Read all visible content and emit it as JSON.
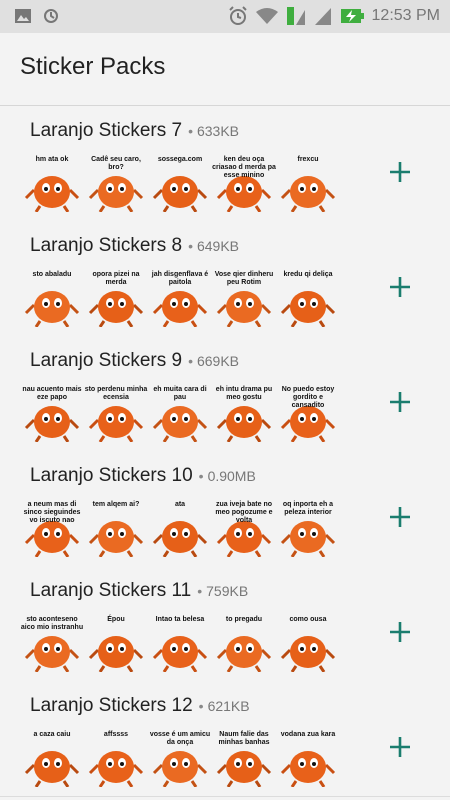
{
  "status_bar": {
    "time": "12:53 PM"
  },
  "app_bar": {
    "title": "Sticker Packs"
  },
  "colors": {
    "accent": "#1a7d6e",
    "orange": "#e8611a",
    "background": "#f3f3f3"
  },
  "packs": [
    {
      "name": "Laranjo Stickers 7",
      "size": "633KB",
      "stickers": [
        "hm ata ok",
        "Cadê seu caro, bro?",
        "sossega.com",
        "ken deu oça criasao d merda pa esse minino",
        "frexcu"
      ]
    },
    {
      "name": "Laranjo Stickers 8",
      "size": "649KB",
      "stickers": [
        "sto abaladu",
        "opora pizei na merda",
        "jah disgenflava é paitola",
        "Vose qier dinheru peu Rotim",
        "kredu qi deliça"
      ]
    },
    {
      "name": "Laranjo Stickers 9",
      "size": "669KB",
      "stickers": [
        "nau acuento mais eze papo",
        "sto perdenu minha ecensia",
        "eh muita cara di pau",
        "eh intu drama pu meo gostu",
        "No puedo estoy gordito e cansadito"
      ]
    },
    {
      "name": "Laranjo Stickers 10",
      "size": "0.90MB",
      "stickers": [
        "a neum mas di sinco sieguindes vo iscuto nao",
        "tem alqem ai?",
        "ata",
        "zua iveja bate no meo pogozume e volta",
        "oq inporta eh a peleza interior"
      ]
    },
    {
      "name": "Laranjo Stickers 11",
      "size": "759KB",
      "stickers": [
        "sto aconteseno aico mio instranhu",
        "Épou",
        "Intao ta belesa",
        "to pregadu",
        "como ousa"
      ]
    },
    {
      "name": "Laranjo Stickers 12",
      "size": "621KB",
      "stickers": [
        "a caza caiu",
        "affssss",
        "vosse é um amicu da onça",
        "Naum falie das minhas banhas",
        "vodana zua kara"
      ]
    }
  ]
}
